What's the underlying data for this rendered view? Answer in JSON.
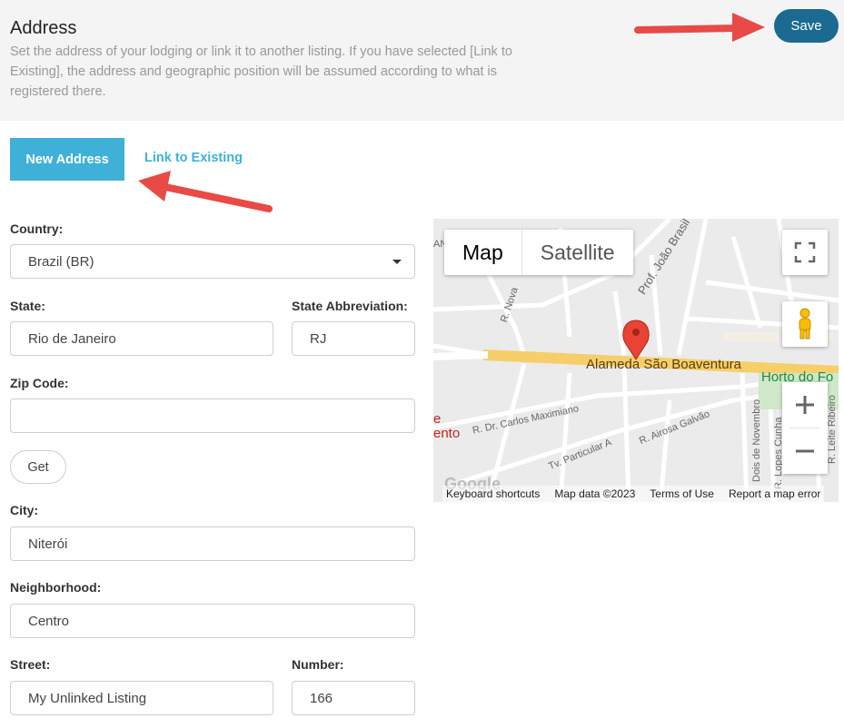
{
  "header": {
    "title": "Address",
    "description": "Set the address of your lodging or link it to another listing. If you have selected [Link to Existing], the address and geographic position will be assumed according to what is registered there.",
    "save_label": "Save"
  },
  "tabs": {
    "new_address": "New Address",
    "link_existing": "Link to Existing"
  },
  "form": {
    "country_label": "Country:",
    "country_value": "Brazil (BR)",
    "state_label": "State:",
    "state_value": "Rio de Janeiro",
    "state_abbr_label": "State Abbreviation:",
    "state_abbr_value": "RJ",
    "zip_label": "Zip Code:",
    "zip_value": "",
    "get_label": "Get",
    "city_label": "City:",
    "city_value": "Niterói",
    "neighborhood_label": "Neighborhood:",
    "neighborhood_value": "Centro",
    "street_label": "Street:",
    "street_value": "My Unlinked Listing",
    "number_label": "Number:",
    "number_value": "166"
  },
  "map": {
    "type_map": "Map",
    "type_satellite": "Satellite",
    "main_street": "Alameda São Boaventura",
    "poi": "Horto do Fo",
    "streets": [
      "Prof. João Brasil",
      "R. Nova",
      "R. Dr. Carlos Maximiano",
      "R. Airosa Galvão",
      "Tv. Particular A",
      "Dois de Novembro",
      "R. Lopes Cunha",
      "R. Leite Ribeiro",
      "AN",
      "e",
      "ento"
    ],
    "footer": {
      "shortcuts": "Keyboard shortcuts",
      "mapdata": "Map data ©2023",
      "terms": "Terms of Use",
      "report": "Report a map error"
    },
    "google": "Google"
  }
}
